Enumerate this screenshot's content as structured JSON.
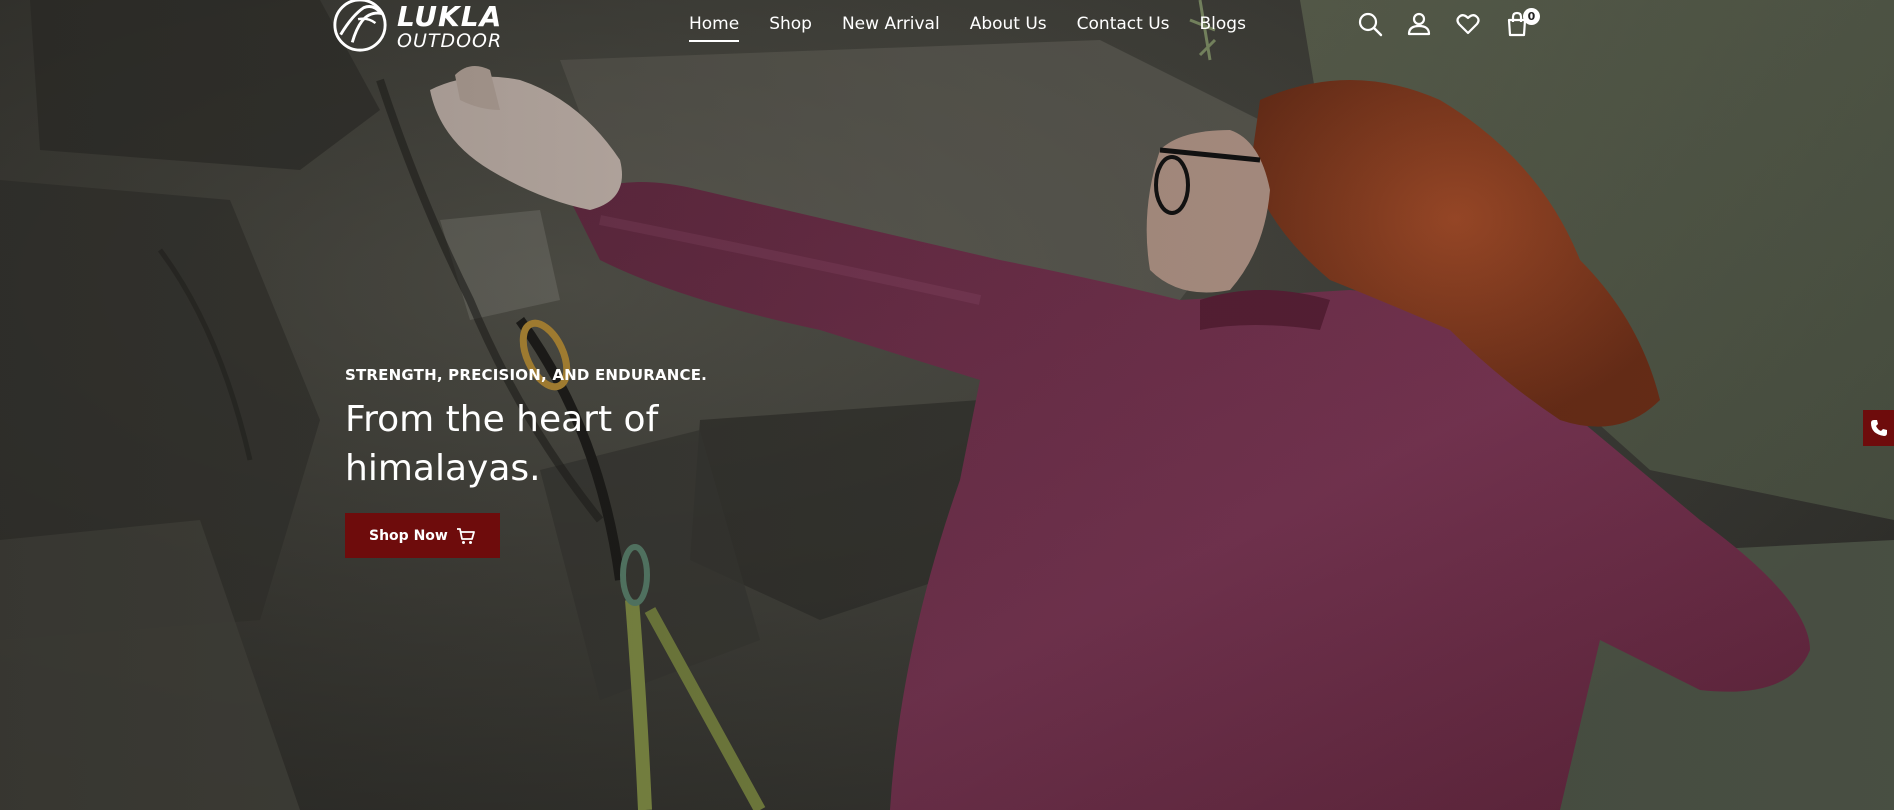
{
  "brand": {
    "name": "LUKLA",
    "tagline": "OUTDOOR"
  },
  "nav": {
    "items": [
      {
        "label": "Home",
        "active": true
      },
      {
        "label": "Shop",
        "active": false
      },
      {
        "label": "New Arrival",
        "active": false
      },
      {
        "label": "About Us",
        "active": false
      },
      {
        "label": "Contact Us",
        "active": false
      },
      {
        "label": "Blogs",
        "active": false
      }
    ]
  },
  "header_icons": [
    "search-icon",
    "user-icon",
    "heart-icon",
    "cart-icon"
  ],
  "cart": {
    "count": "0"
  },
  "hero": {
    "eyebrow": "STRENGTH, PRECISION, AND ENDURANCE.",
    "headline": "From the heart of himalayas.",
    "cta_label": "Shop Now"
  },
  "colors": {
    "accent": "#6e0c0c",
    "text": "#ffffff",
    "sweater": "#7a3554",
    "hair": "#8f3f22",
    "rock": "#4a4a43"
  }
}
